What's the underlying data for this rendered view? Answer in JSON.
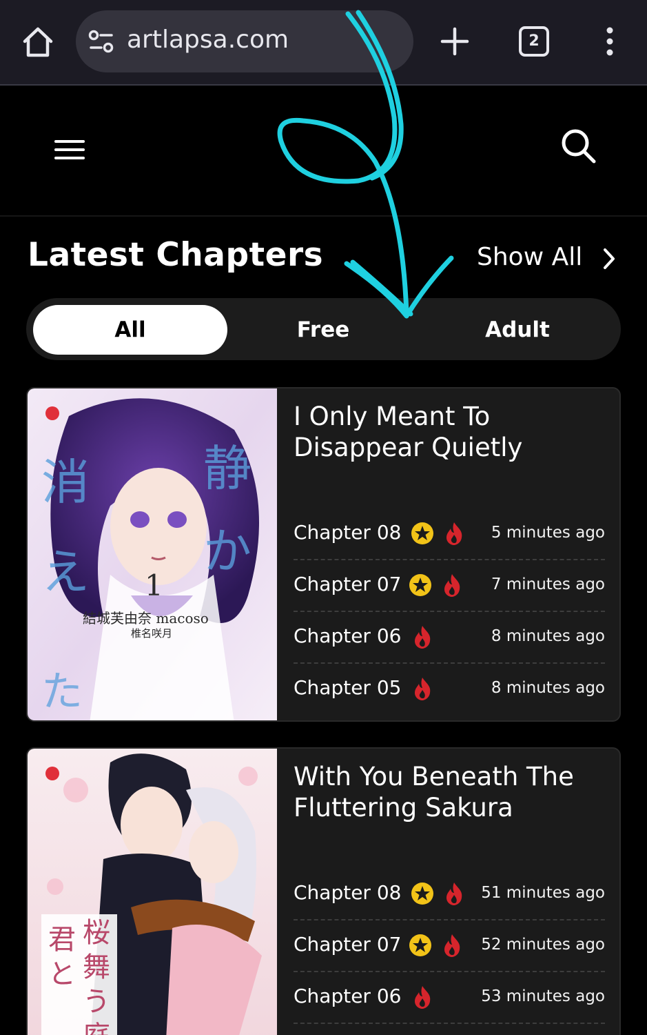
{
  "browser": {
    "url": "artlapsa.com",
    "tab_count": "2",
    "icons": [
      "home-icon",
      "site-settings-icon",
      "plus-icon",
      "tabs-icon",
      "more-vert-icon"
    ]
  },
  "header": {
    "icons": [
      "hamburger-icon",
      "search-icon"
    ]
  },
  "section": {
    "title": "Latest Chapters",
    "show_all": "Show All"
  },
  "filters": [
    {
      "label": "All",
      "active": true
    },
    {
      "label": "Free",
      "active": false
    },
    {
      "label": "Adult",
      "active": false
    }
  ],
  "colors": {
    "annotation_arrow": "#1fd0e0",
    "star_badge": "#f2c318",
    "fire_badge": "#d6252c"
  },
  "cards": [
    {
      "title": "I Only Meant To Disappear Quietly",
      "chapters": [
        {
          "label": "Chapter 08",
          "premium": true,
          "hot": true,
          "time": "5 minutes ago"
        },
        {
          "label": "Chapter 07",
          "premium": true,
          "hot": true,
          "time": "7 minutes ago"
        },
        {
          "label": "Chapter 06",
          "premium": false,
          "hot": true,
          "time": "8 minutes ago"
        },
        {
          "label": "Chapter 05",
          "premium": false,
          "hot": true,
          "time": "8 minutes ago"
        }
      ]
    },
    {
      "title": "With You Beneath The Fluttering Sakura",
      "chapters": [
        {
          "label": "Chapter 08",
          "premium": true,
          "hot": true,
          "time": "51 minutes ago"
        },
        {
          "label": "Chapter 07",
          "premium": true,
          "hot": true,
          "time": "52 minutes ago"
        },
        {
          "label": "Chapter 06",
          "premium": false,
          "hot": true,
          "time": "53 minutes ago"
        }
      ]
    }
  ]
}
